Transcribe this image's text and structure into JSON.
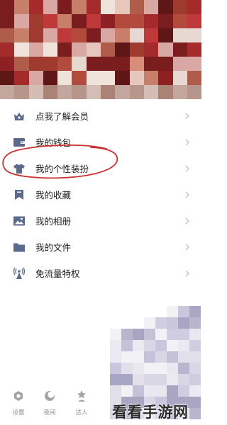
{
  "menu": {
    "items": [
      {
        "label": "点我了解会员",
        "icon": "crown-icon"
      },
      {
        "label": "我的钱包",
        "icon": "wallet-icon"
      },
      {
        "label": "我的个性装扮",
        "icon": "tshirt-icon"
      },
      {
        "label": "我的收藏",
        "icon": "bookmark-icon"
      },
      {
        "label": "我的相册",
        "icon": "image-icon"
      },
      {
        "label": "我的文件",
        "icon": "folder-icon"
      },
      {
        "label": "免流量特权",
        "icon": "antenna-icon"
      }
    ]
  },
  "bottom_bar": {
    "tabs": [
      {
        "label": "设置",
        "icon": "gear-icon"
      },
      {
        "label": "夜间",
        "icon": "moon-icon"
      },
      {
        "label": "达人",
        "icon": "star-person-icon"
      }
    ]
  },
  "watermark": "看看手游网",
  "colors": {
    "icon": "#5b6a8c",
    "annotation": "#c8322f",
    "chevron": "#c4c4c4"
  }
}
